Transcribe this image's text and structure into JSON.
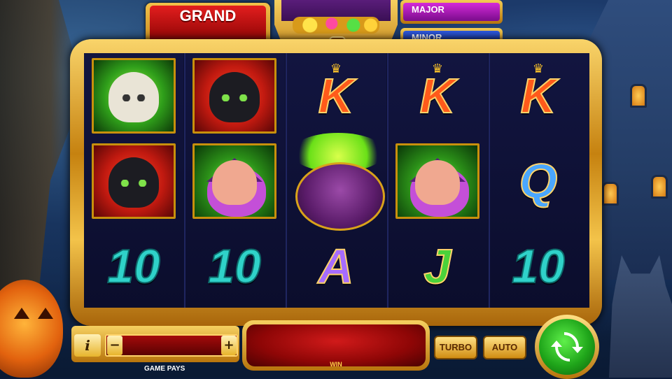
{
  "jackpots": {
    "grand": "GRAND",
    "major": "MAJOR",
    "minor": "MINOR"
  },
  "reels": [
    [
      {
        "symbol": "owl",
        "type": "image"
      },
      {
        "symbol": "cat",
        "type": "image"
      },
      {
        "symbol": "10",
        "type": "letter"
      }
    ],
    [
      {
        "symbol": "cat",
        "type": "image"
      },
      {
        "symbol": "witch",
        "type": "image"
      },
      {
        "symbol": "10",
        "type": "letter"
      }
    ],
    [
      {
        "symbol": "K",
        "type": "letter"
      },
      {
        "symbol": "cauldron",
        "type": "image"
      },
      {
        "symbol": "A",
        "type": "letter"
      }
    ],
    [
      {
        "symbol": "K",
        "type": "letter"
      },
      {
        "symbol": "witch",
        "type": "image"
      },
      {
        "symbol": "J",
        "type": "letter"
      }
    ],
    [
      {
        "symbol": "K",
        "type": "letter"
      },
      {
        "symbol": "Q",
        "type": "letter"
      },
      {
        "symbol": "10",
        "type": "letter"
      }
    ]
  ],
  "controls": {
    "info": "i",
    "minus": "−",
    "plus": "+",
    "game_pays_label": "GAME PAYS",
    "win_label": "WIN",
    "turbo": "TURBO",
    "auto": "AUTO"
  },
  "colors": {
    "grand": "#d81818",
    "major": "#b11ec6",
    "minor": "#1a3fbf",
    "frame_gold": "#e6a828",
    "spin_green": "#1fa51a"
  },
  "icons": {
    "spin": "refresh-arrows-icon",
    "info": "info-icon"
  }
}
